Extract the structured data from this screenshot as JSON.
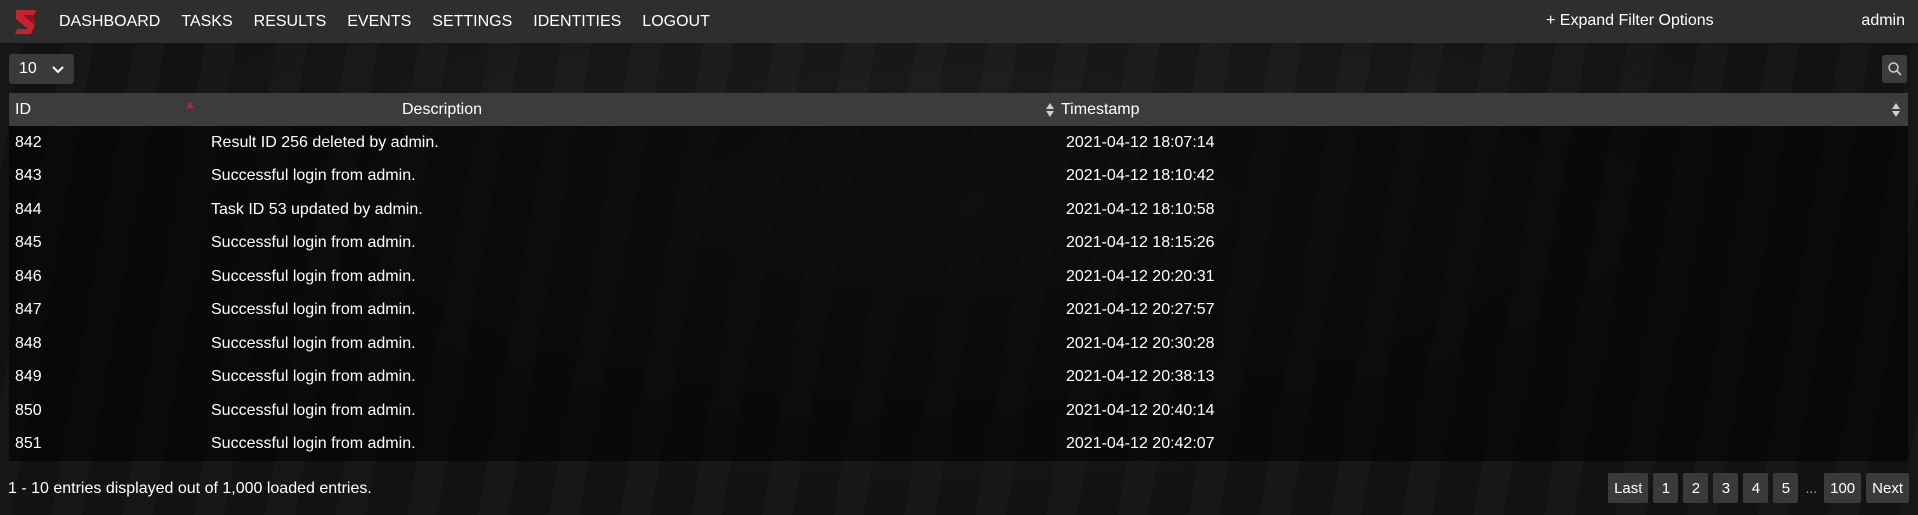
{
  "nav": {
    "items": [
      "DASHBOARD",
      "TASKS",
      "RESULTS",
      "EVENTS",
      "SETTINGS",
      "IDENTITIES",
      "LOGOUT"
    ],
    "filter_toggle": "+ Expand Filter Options",
    "user": "admin",
    "logo_icon": "brand-s-logo",
    "brand_color": "#c8202f"
  },
  "toolbar": {
    "page_size": "10",
    "search_icon": "search-icon"
  },
  "table": {
    "columns": [
      "ID",
      "Description",
      "Timestamp"
    ],
    "sort": {
      "column": "ID",
      "direction": "ascending",
      "color": "#c8202f"
    },
    "rows": [
      {
        "id": "842",
        "description": "Result ID 256 deleted by admin.",
        "timestamp": "2021-04-12 18:07:14"
      },
      {
        "id": "843",
        "description": "Successful login from admin.",
        "timestamp": "2021-04-12 18:10:42"
      },
      {
        "id": "844",
        "description": "Task ID 53 updated by admin.",
        "timestamp": "2021-04-12 18:10:58"
      },
      {
        "id": "845",
        "description": "Successful login from admin.",
        "timestamp": "2021-04-12 18:15:26"
      },
      {
        "id": "846",
        "description": "Successful login from admin.",
        "timestamp": "2021-04-12 20:20:31"
      },
      {
        "id": "847",
        "description": "Successful login from admin.",
        "timestamp": "2021-04-12 20:27:57"
      },
      {
        "id": "848",
        "description": "Successful login from admin.",
        "timestamp": "2021-04-12 20:30:28"
      },
      {
        "id": "849",
        "description": "Successful login from admin.",
        "timestamp": "2021-04-12 20:38:13"
      },
      {
        "id": "850",
        "description": "Successful login from admin.",
        "timestamp": "2021-04-12 20:40:14"
      },
      {
        "id": "851",
        "description": "Successful login from admin.",
        "timestamp": "2021-04-12 20:42:07"
      }
    ]
  },
  "footer": {
    "summary": "1 - 10 entries displayed out of 1,000 loaded entries.",
    "pager": {
      "last": "Last",
      "pages": [
        "1",
        "2",
        "3",
        "4",
        "5"
      ],
      "ellipsis": "...",
      "final_page": "100",
      "next": "Next"
    }
  }
}
